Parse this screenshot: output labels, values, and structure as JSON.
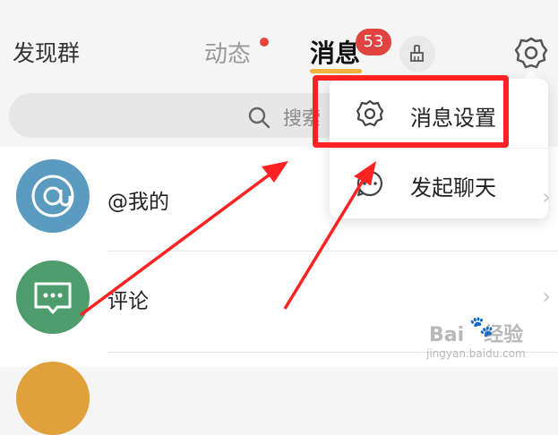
{
  "header": {
    "left_title": "发现群",
    "tab_dongtai": "动态",
    "tab_xiaoxi": "消息",
    "badge_count": "53"
  },
  "search": {
    "placeholder": "搜索"
  },
  "rows": [
    {
      "label": "@我的"
    },
    {
      "label": "评论"
    }
  ],
  "popup": {
    "items": [
      {
        "label": "消息设置"
      },
      {
        "label": "发起聊天"
      }
    ]
  },
  "watermark": {
    "brand": "Bai",
    "brand2": "经验",
    "sub": "jingyan.baidu.com"
  },
  "colors": {
    "accent_underline": "#f0b33c",
    "badge": "#e1443e",
    "avatar_at": "#5b9bbf",
    "avatar_comment": "#4f9c6c",
    "highlight": "#ff2222"
  }
}
